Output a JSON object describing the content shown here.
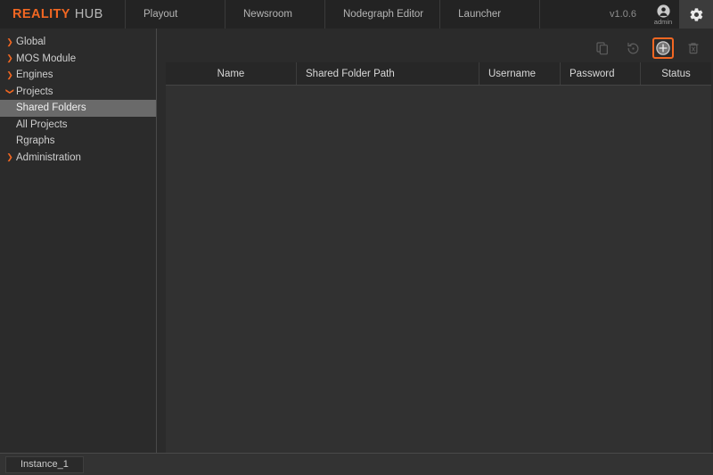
{
  "app": {
    "brand_primary": "REALITY",
    "brand_secondary": "HUB",
    "accent_color": "#f26722"
  },
  "header": {
    "nav": [
      {
        "label": "Playout"
      },
      {
        "label": "Newsroom"
      },
      {
        "label": "Nodegraph Editor"
      },
      {
        "label": "Launcher"
      }
    ],
    "version": "v1.0.6",
    "user": {
      "name": "admin",
      "icon": "user-circle-icon"
    },
    "settings": {
      "icon": "gear-icon"
    }
  },
  "sidebar": {
    "items": [
      {
        "label": "Global",
        "level": 0,
        "expanded": false,
        "selected": false
      },
      {
        "label": "MOS Module",
        "level": 0,
        "expanded": false,
        "selected": false
      },
      {
        "label": "Engines",
        "level": 0,
        "expanded": false,
        "selected": false
      },
      {
        "label": "Projects",
        "level": 0,
        "expanded": true,
        "selected": false
      },
      {
        "label": "Shared Folders",
        "level": 1,
        "expanded": null,
        "selected": true
      },
      {
        "label": "All Projects",
        "level": 1,
        "expanded": null,
        "selected": false
      },
      {
        "label": "Rgraphs",
        "level": 1,
        "expanded": null,
        "selected": false
      },
      {
        "label": "Administration",
        "level": 0,
        "expanded": false,
        "selected": false
      }
    ]
  },
  "toolbar": {
    "buttons": [
      {
        "name": "duplicate-button",
        "icon": "copy-icon",
        "state": "disabled"
      },
      {
        "name": "revert-button",
        "icon": "undo-icon",
        "state": "disabled"
      },
      {
        "name": "add-button",
        "icon": "plus-circle-icon",
        "state": "active"
      },
      {
        "name": "delete-button",
        "icon": "trash-icon",
        "state": "disabled"
      }
    ]
  },
  "table": {
    "columns": [
      {
        "label": "Name"
      },
      {
        "label": "Shared Folder Path"
      },
      {
        "label": "Username"
      },
      {
        "label": "Password"
      },
      {
        "label": "Status"
      }
    ],
    "rows": []
  },
  "statusbar": {
    "instance_tab": "Instance_1"
  }
}
